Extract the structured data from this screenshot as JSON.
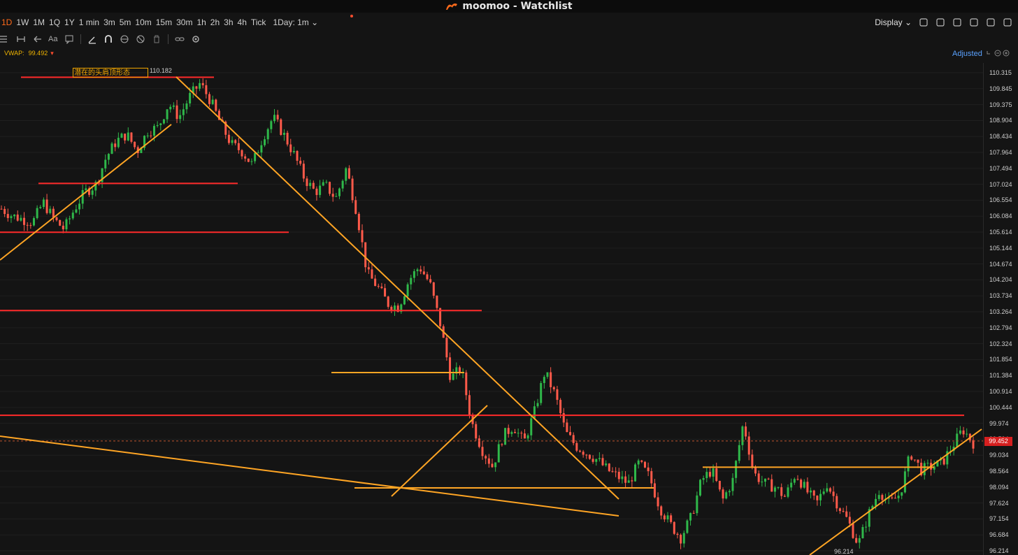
{
  "window": {
    "title": "moomoo - Watchlist"
  },
  "toolbar": {
    "timeframes": [
      "1D",
      "1W",
      "1M",
      "1Q",
      "1Y",
      "1 min",
      "3m",
      "5m",
      "10m",
      "15m",
      "30m",
      "1h",
      "2h",
      "3h",
      "4h",
      "Tick"
    ],
    "active_timeframe": "1D",
    "interval_select": "1Day: 1m",
    "display_label": "Display"
  },
  "drawing_tools": [
    "menu-icon",
    "arrow-back-icon",
    "text-icon",
    "comment-icon",
    "pencil-icon",
    "magnet-icon",
    "eye-icon",
    "hide-icon",
    "trash-icon",
    "link-icon",
    "settings-icon"
  ],
  "indicator": {
    "name": "VWAP:",
    "value": "99.492"
  },
  "adjusted_label": "Adjusted",
  "annotation": {
    "text": "潜在的头肩顶形态"
  },
  "high_label": "110.182",
  "low_label": "96.214",
  "current_price": "99.452",
  "colors": {
    "accent": "#ff6a1a",
    "up": "#2fb84a",
    "down": "#ff5a4a",
    "line_red": "#ff2a2a",
    "line_orange": "#ffa524",
    "vwap": "#f0b400"
  },
  "chart_data": {
    "type": "candlestick",
    "y_axis_ticks": [
      "110.315",
      "109.845",
      "109.375",
      "108.904",
      "108.434",
      "107.964",
      "107.494",
      "107.024",
      "106.554",
      "106.084",
      "105.614",
      "105.144",
      "104.674",
      "104.204",
      "103.734",
      "103.264",
      "102.794",
      "102.324",
      "101.854",
      "101.384",
      "100.914",
      "100.444",
      "99.974",
      "99.504",
      "99.034",
      "98.564",
      "98.094",
      "97.624",
      "97.154",
      "96.684",
      "96.214"
    ],
    "ylim": [
      96.0,
      110.5
    ],
    "close_path": [
      106.3,
      106.1,
      106.0,
      105.9,
      106.5,
      106.0,
      105.7,
      106.3,
      106.8,
      107.0,
      107.8,
      108.3,
      108.5,
      108.0,
      108.6,
      108.7,
      109.4,
      109.0,
      109.6,
      110.0,
      109.5,
      108.8,
      108.2,
      108.0,
      107.6,
      108.4,
      109.0,
      108.5,
      107.9,
      107.2,
      106.8,
      107.0,
      106.6,
      107.5,
      106.2,
      104.4,
      104.0,
      103.5,
      103.4,
      104.2,
      104.6,
      104.1,
      102.9,
      101.3,
      101.6,
      100.0,
      99.2,
      98.7,
      99.6,
      99.9,
      99.4,
      100.3,
      101.5,
      100.8,
      99.7,
      99.3,
      99.1,
      98.9,
      98.6,
      98.4,
      98.2,
      98.8,
      98.4,
      97.5,
      97.0,
      96.6,
      97.2,
      98.3,
      98.6,
      97.7,
      98.3,
      100.0,
      98.5,
      98.2,
      98.1,
      97.8,
      98.5,
      98.0,
      97.6,
      98.2,
      97.6,
      97.1,
      96.4,
      97.3,
      98.0,
      97.6,
      97.9,
      99.1,
      98.6,
      98.7,
      98.8,
      99.3,
      99.8,
      99.4
    ],
    "horizontal_levels_red": [
      110.18,
      107.05,
      105.61,
      103.3,
      100.21
    ],
    "horizontal_levels_orange": [
      101.47,
      98.07,
      98.68
    ],
    "resistance_level_dashed": 99.452
  }
}
